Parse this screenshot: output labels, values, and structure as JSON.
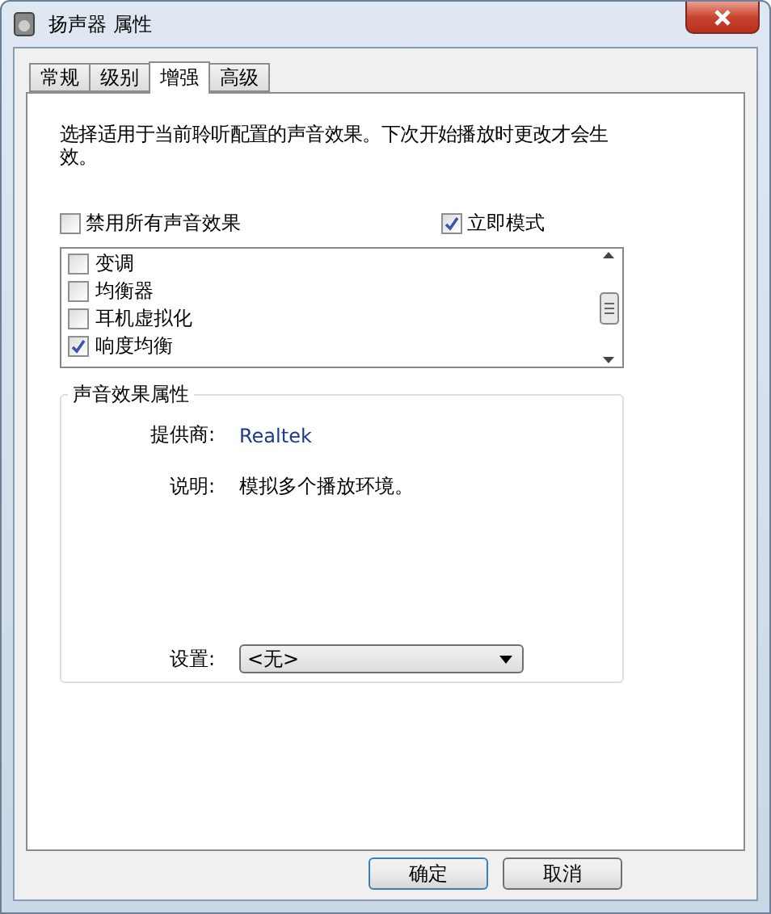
{
  "window": {
    "title": "扬声器 属性"
  },
  "tabs": [
    {
      "label": "常规",
      "selected": false
    },
    {
      "label": "级别",
      "selected": false
    },
    {
      "label": "增强",
      "selected": true
    },
    {
      "label": "高级",
      "selected": false
    }
  ],
  "description": "选择适用于当前聆听配置的声音效果。下次开始播放时更改才会生效。",
  "options": [
    {
      "label": "禁用所有声音效果",
      "checked": false
    },
    {
      "label": "立即模式",
      "checked": true
    }
  ],
  "effects": [
    {
      "label": "变调",
      "checked": false
    },
    {
      "label": "均衡器",
      "checked": false
    },
    {
      "label": "耳机虚拟化",
      "checked": false
    },
    {
      "label": "响度均衡",
      "checked": true
    }
  ],
  "properties": {
    "title": "声音效果属性",
    "provider_label": "提供商:",
    "provider": "Realtek",
    "description_label": "说明:",
    "description": "模拟多个播放环境。",
    "setting_label": "设置:",
    "setting": "<无>"
  },
  "buttons": [
    "确定",
    "取消"
  ]
}
